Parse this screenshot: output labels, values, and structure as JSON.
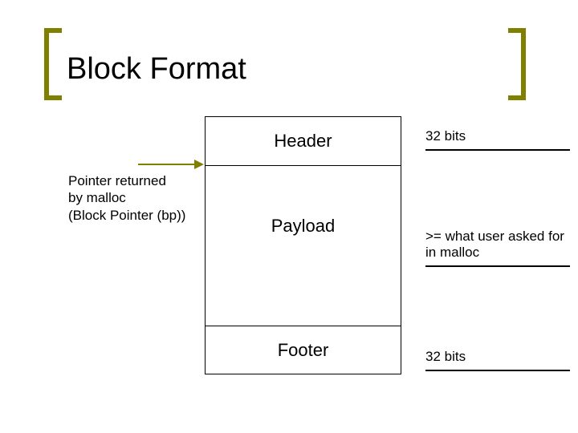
{
  "title": "Block Format",
  "block": {
    "header": "Header",
    "payload": "Payload",
    "footer": "Footer"
  },
  "annotations": {
    "header_size": "32 bits",
    "payload_note": ">= what user asked for in malloc",
    "footer_size": "32 bits"
  },
  "pointer_label_line1": "Pointer returned",
  "pointer_label_line2": "by malloc",
  "pointer_label_line3": "(Block Pointer (bp))"
}
